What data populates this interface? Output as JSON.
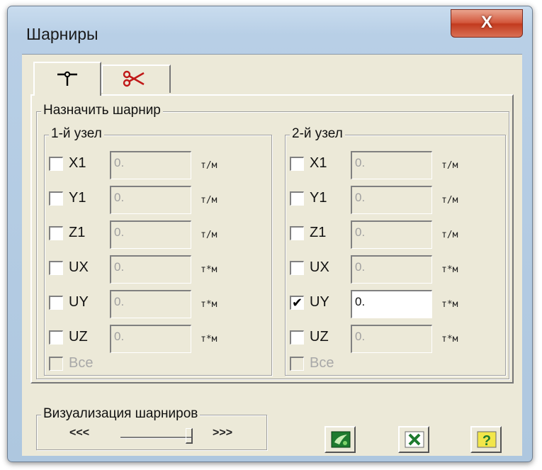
{
  "window": {
    "title": "Шарниры",
    "close_glyph": "X"
  },
  "tabs": [
    {
      "icon": "hinge-icon"
    },
    {
      "icon": "scissors-icon"
    }
  ],
  "assign_group": {
    "label": "Назначить шарнир"
  },
  "node1": {
    "label": "1-й узел",
    "rows": [
      {
        "name": "X1",
        "value": "0.",
        "unit": "т/м",
        "checked": false
      },
      {
        "name": "Y1",
        "value": "0.",
        "unit": "т/м",
        "checked": false
      },
      {
        "name": "Z1",
        "value": "0.",
        "unit": "т/м",
        "checked": false
      },
      {
        "name": "UX",
        "value": "0.",
        "unit": "т*м",
        "checked": false
      },
      {
        "name": "UY",
        "value": "0.",
        "unit": "т*м",
        "checked": false
      },
      {
        "name": "UZ",
        "value": "0.",
        "unit": "т*м",
        "checked": false
      }
    ],
    "all_label": "Все"
  },
  "node2": {
    "label": "2-й узел",
    "rows": [
      {
        "name": "X1",
        "value": "0.",
        "unit": "т/м",
        "checked": false
      },
      {
        "name": "Y1",
        "value": "0.",
        "unit": "т/м",
        "checked": false
      },
      {
        "name": "Z1",
        "value": "0.",
        "unit": "т/м",
        "checked": false
      },
      {
        "name": "UX",
        "value": "0.",
        "unit": "т*м",
        "checked": false
      },
      {
        "name": "UY",
        "value": "0.",
        "unit": "т*м",
        "checked": true
      },
      {
        "name": "UZ",
        "value": "0.",
        "unit": "т*м",
        "checked": false
      }
    ],
    "all_label": "Все"
  },
  "visualization": {
    "label": "Визуализация шарниров",
    "left_label": "<<<",
    "right_label": ">>>",
    "slider_level": 1.0
  },
  "buttons": [
    {
      "icon": "apply-icon"
    },
    {
      "icon": "cancel-icon"
    },
    {
      "icon": "help-icon",
      "text": "?"
    }
  ],
  "colors": {
    "check_mark": "✔",
    "accent_green": "#1e7a2e",
    "help_yellow": "#f2e64a"
  }
}
